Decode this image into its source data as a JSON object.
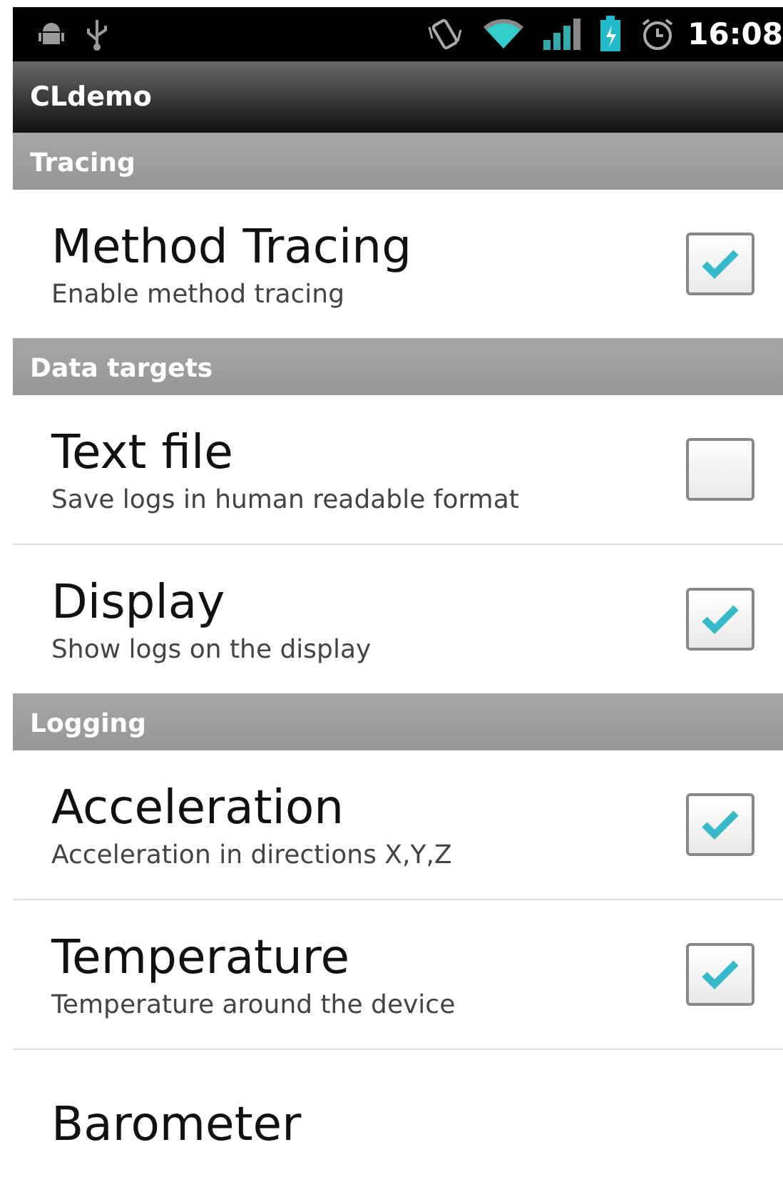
{
  "status_bar": {
    "time": "16:08"
  },
  "title_bar": {
    "title": "CLdemo"
  },
  "sections": [
    {
      "header": "Tracing",
      "items": [
        {
          "title": "Method Tracing",
          "summary": "Enable method tracing",
          "checked": true
        }
      ]
    },
    {
      "header": "Data targets",
      "items": [
        {
          "title": "Text file",
          "summary": "Save logs in human readable format",
          "checked": false
        },
        {
          "title": "Display",
          "summary": "Show logs on the display",
          "checked": true
        }
      ]
    },
    {
      "header": "Logging",
      "items": [
        {
          "title": "Acceleration",
          "summary": "Acceleration in directions X,Y,Z",
          "checked": true
        },
        {
          "title": "Temperature",
          "summary": "Temperature around the device",
          "checked": true
        },
        {
          "title": "Barometer"
        }
      ]
    }
  ]
}
